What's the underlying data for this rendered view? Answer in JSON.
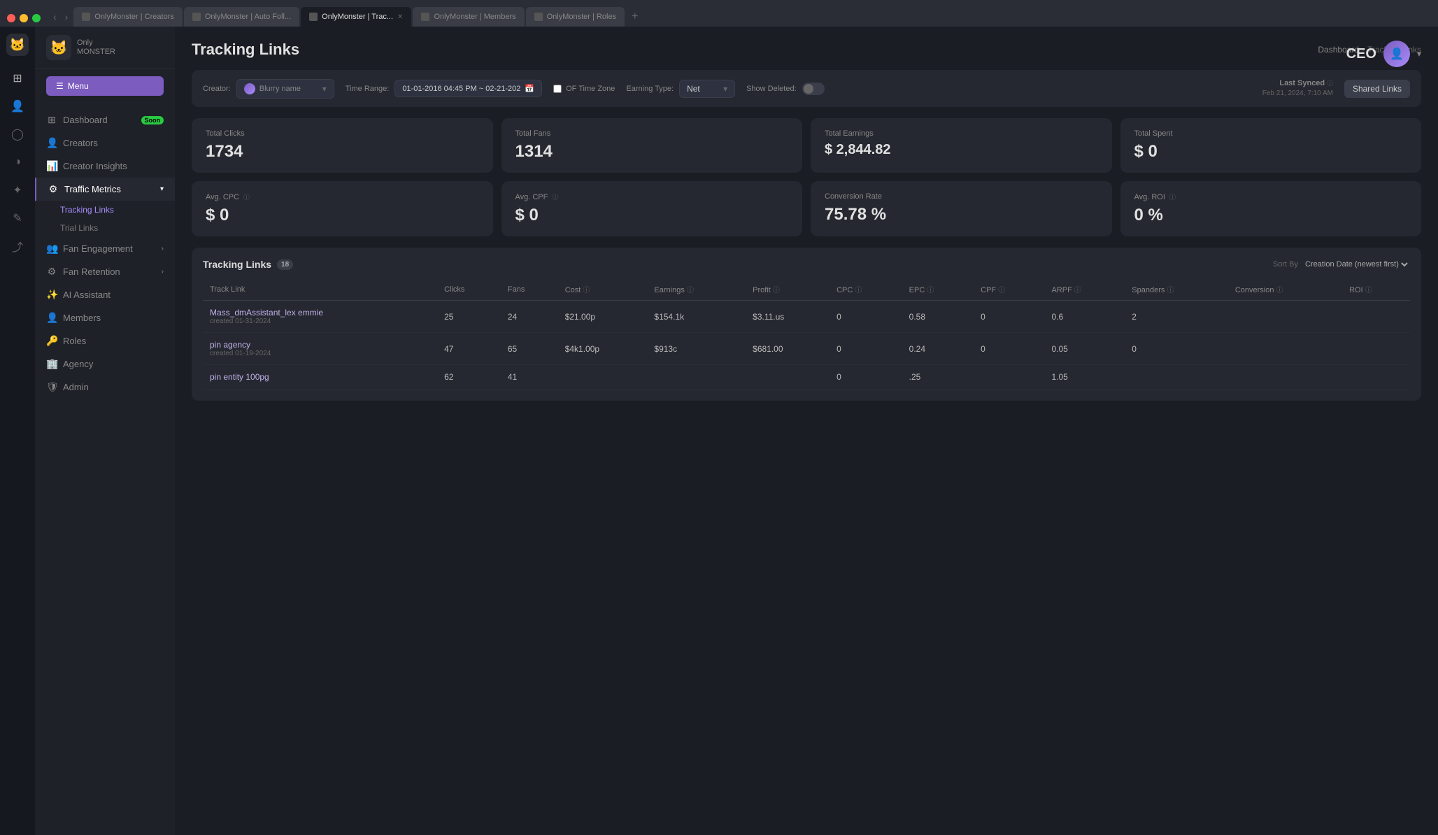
{
  "browser": {
    "tabs": [
      {
        "label": "OnlyMonster | Creators",
        "active": false,
        "icon": "🐱"
      },
      {
        "label": "OnlyMonster | Auto Foll...",
        "active": false,
        "icon": "🐱"
      },
      {
        "label": "OnlyMonster | Trac...",
        "active": true,
        "icon": "🐱"
      },
      {
        "label": "OnlyMonster | Members",
        "active": false,
        "icon": "🐱"
      },
      {
        "label": "OnlyMonster | Roles",
        "active": false,
        "icon": "🐱"
      }
    ]
  },
  "sidebar": {
    "brand_name": "Only",
    "brand_sub": "MONSTER",
    "menu_label": "Menu",
    "items": [
      {
        "label": "Dashboard",
        "icon": "⊞",
        "badge": "Soon"
      },
      {
        "label": "Creators",
        "icon": "👤"
      },
      {
        "label": "Creator Insights",
        "icon": "📊"
      },
      {
        "label": "Traffic Metrics",
        "icon": "⚙",
        "active": true,
        "expanded": true
      },
      {
        "label": "Fan Engagement",
        "icon": "👥",
        "has_chevron": true
      },
      {
        "label": "Fan Retention",
        "icon": "⚙",
        "has_chevron": true
      },
      {
        "label": "AI Assistant",
        "icon": "✨"
      },
      {
        "label": "Members",
        "icon": "👤"
      },
      {
        "label": "Roles",
        "icon": "🔑"
      },
      {
        "label": "Agency",
        "icon": "🏢"
      },
      {
        "label": "Admin",
        "icon": "🛡"
      }
    ],
    "sub_items": [
      {
        "label": "Tracking Links",
        "active": true
      },
      {
        "label": "Trial Links"
      }
    ]
  },
  "page": {
    "title": "Tracking Links",
    "breadcrumb_home": "Dashboard",
    "breadcrumb_current": "Tracking Links"
  },
  "filters": {
    "creator_label": "Creator:",
    "creator_value": "Blurry name",
    "time_range_label": "Time Range:",
    "time_range_value": "01-01-2016 04:45 PM ~ 02-21-202",
    "of_timezone_label": "OF Time Zone",
    "earning_type_label": "Earning Type:",
    "earning_type_value": "Net",
    "show_deleted_label": "Show Deleted:",
    "last_synced_label": "Last Synced",
    "last_synced_date": "Feb 21, 2024, 7:10 AM",
    "shared_links_label": "Shared Links"
  },
  "stats": [
    {
      "label": "Total Clicks",
      "value": "1734"
    },
    {
      "label": "Total Fans",
      "value": "1314"
    },
    {
      "label": "Total Earnings",
      "value": "$ 2,844.82"
    },
    {
      "label": "Total Spent",
      "value": "$ 0"
    }
  ],
  "stats2": [
    {
      "label": "Avg. CPC",
      "value": "$ 0"
    },
    {
      "label": "Avg. CPF",
      "value": "$ 0"
    },
    {
      "label": "Conversion Rate",
      "value": "75.78 %"
    },
    {
      "label": "Avg. ROI",
      "value": "0 %"
    }
  ],
  "tracking_links": {
    "title": "Tracking Links",
    "count": "18",
    "sort_by_label": "Sort By",
    "sort_by_value": "Creation Date (newest first)",
    "columns": [
      "Track Link",
      "Clicks",
      "Fans",
      "Cost",
      "Earnings",
      "Profit",
      "CPC",
      "EPC",
      "CPF",
      "ARPF",
      "Spanders",
      "Conversion",
      "ROI"
    ],
    "rows": [
      {
        "name": "Mass_dmAssistant_lex emmie",
        "date": "created 01-31-2024",
        "clicks": "25",
        "fans": "24",
        "cost": "$21.00p",
        "earnings": "$154.1k",
        "profit": "$3.11.us",
        "cpc": "0",
        "epc": "0.58",
        "cpf": "0",
        "arpf": "0.6",
        "spanders": "2",
        "conversion": "",
        "roi": ""
      },
      {
        "name": "pin agency",
        "date": "created 01-19-2024",
        "clicks": "47",
        "fans": "65",
        "cost": "$4k1.00p",
        "earnings": "$913c",
        "profit": "$681.00",
        "cpc": "0",
        "epc": "0.24",
        "cpf": "0",
        "arpf": "0.05",
        "spanders": "0",
        "conversion": "",
        "roi": ""
      },
      {
        "name": "pin entity 100pg",
        "date": "",
        "clicks": "62",
        "fans": "41",
        "cost": "",
        "earnings": "",
        "profit": "",
        "cpc": "0",
        "epc": ".25",
        "cpf": "",
        "arpf": "1.05",
        "spanders": "",
        "conversion": "",
        "roi": ""
      }
    ]
  },
  "user": {
    "role": "CEO",
    "avatar_initial": "👤"
  }
}
